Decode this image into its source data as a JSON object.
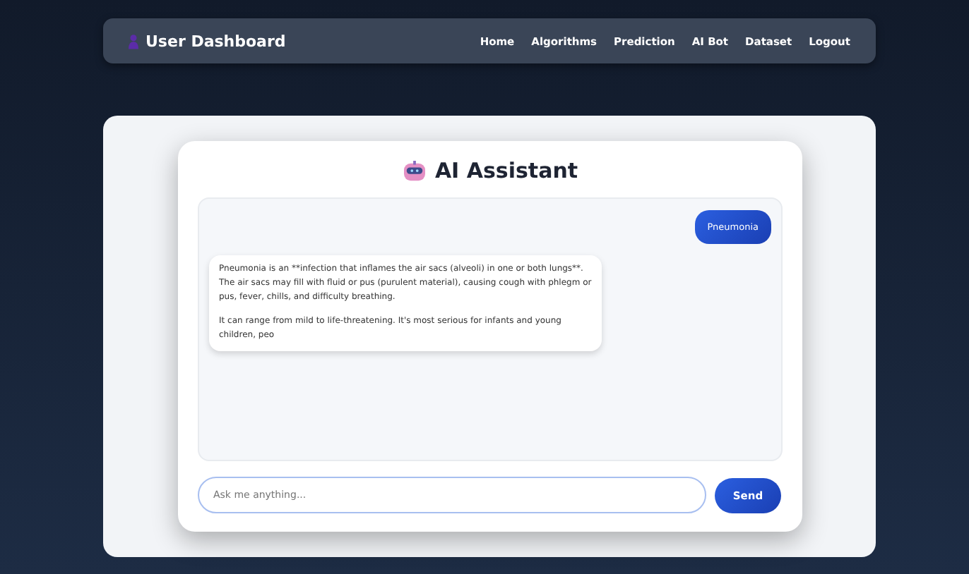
{
  "navbar": {
    "brand": "User Dashboard",
    "links": [
      "Home",
      "Algorithms",
      "Prediction",
      "AI Bot",
      "Dataset",
      "Logout"
    ]
  },
  "chat": {
    "title": "AI Assistant",
    "messages": [
      {
        "kind": "user",
        "paragraphs": [
          "Pneumonia"
        ]
      },
      {
        "kind": "bot",
        "paragraphs": [
          "Pneumonia is an **infection that inflames the air sacs (alveoli) in one or both lungs**. The air sacs may fill with fluid or pus (purulent material), causing cough with phlegm or pus, fever, chills, and difficulty breathing.",
          "It can range from mild to life-threatening. It's most serious for infants and young children, peo"
        ]
      }
    ],
    "input": {
      "placeholder": "Ask me anything..."
    },
    "send_button": "Send"
  }
}
